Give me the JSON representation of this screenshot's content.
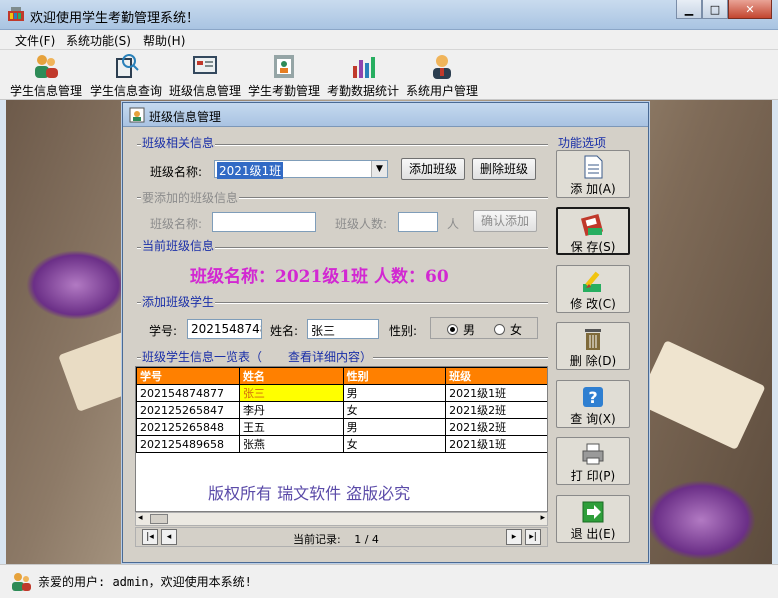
{
  "window": {
    "title": "欢迎使用学生考勤管理系统！",
    "min_glyph": "▁",
    "max_glyph": "□",
    "close_glyph": "✕"
  },
  "menu": {
    "items": [
      "文件(F)",
      "系统功能(S)",
      "帮助(H)"
    ]
  },
  "toolbar": {
    "items": [
      {
        "label": "学生信息管理",
        "icon": "users-icon"
      },
      {
        "label": "学生信息查询",
        "icon": "search-book-icon"
      },
      {
        "label": "班级信息管理",
        "icon": "class-board-icon"
      },
      {
        "label": "学生考勤管理",
        "icon": "attendance-icon"
      },
      {
        "label": "考勤数据统计",
        "icon": "stats-icon"
      },
      {
        "label": "系统用户管理",
        "icon": "admin-user-icon"
      }
    ]
  },
  "dialog": {
    "title": "班级信息管理",
    "class_related": {
      "section": "班级相关信息",
      "class_name_label": "班级名称:",
      "class_name_value": "2021级1班",
      "add_class_btn": "添加班级",
      "delete_class_btn": "删除班级"
    },
    "add_class": {
      "section": "要添加的班级信息",
      "name_label": "班级名称:",
      "count_label": "班级人数:",
      "count_unit": "人",
      "confirm_btn": "确认添加"
    },
    "current_class": {
      "section": "当前班级信息",
      "summary": "班级名称：2021级1班   人数：60"
    },
    "add_student": {
      "section": "添加班级学生",
      "id_label": "学号:",
      "id_value": "202154874877",
      "name_label": "姓名:",
      "name_value": "张三",
      "gender_label": "性别:",
      "male_label": "男",
      "female_label": "女",
      "gender_selected": "男"
    },
    "student_list": {
      "section": "班级学生信息一览表（",
      "section_suffix": "查看详细内容）",
      "columns": [
        "学号",
        "姓名",
        "性别",
        "班级"
      ],
      "rows": [
        [
          "202154874877",
          "张三",
          "男",
          "2021级1班"
        ],
        [
          "202125265847",
          "李丹",
          "女",
          "2021级2班"
        ],
        [
          "202125265848",
          "王五",
          "男",
          "2021级2班"
        ],
        [
          "202125489658",
          "张燕",
          "女",
          "2021级1班"
        ]
      ],
      "watermark": "版权所有  瑞文软件  盗版必究",
      "record_label": "当前记录:",
      "record_value": "1 / 4"
    },
    "functions": {
      "section": "功能选项",
      "buttons": [
        {
          "label": "添 加(A)",
          "icon": "document-icon"
        },
        {
          "label": "保 存(S)",
          "icon": "save-icon"
        },
        {
          "label": "修 改(C)",
          "icon": "edit-icon"
        },
        {
          "label": "删 除(D)",
          "icon": "trash-icon"
        },
        {
          "label": "查 询(X)",
          "icon": "help-icon"
        },
        {
          "label": "打 印(P)",
          "icon": "printer-icon"
        },
        {
          "label": "退 出(E)",
          "icon": "exit-arrow-icon"
        }
      ]
    }
  },
  "status": {
    "text": "亲爱的用户: admin，欢迎使用本系统!"
  },
  "colors": {
    "accent_blue": "#1a2fa8",
    "summary_magenta": "#d228d2",
    "grid_header": "#ff8000",
    "highlight_yellow": "#ffff00"
  }
}
